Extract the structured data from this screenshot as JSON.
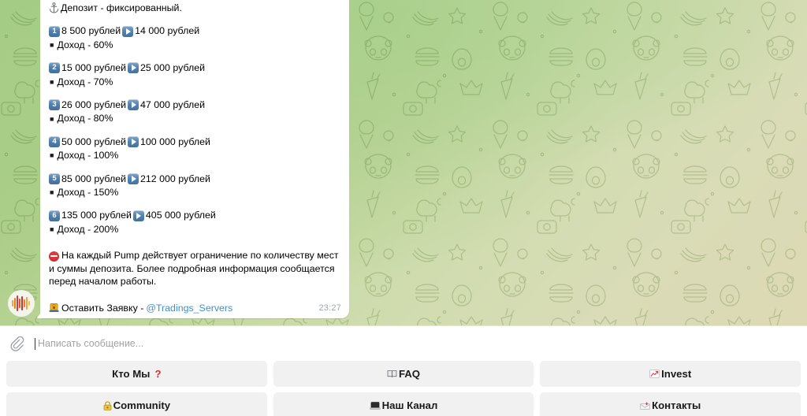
{
  "wallpaper": {
    "colors": {
      "green": "#9ec97f",
      "mid": "#cedcad",
      "khaki": "#d9dcb7"
    }
  },
  "message": {
    "avatar_icon": "audio-waveform-avatar",
    "header": {
      "icon": "anchor-icon",
      "text": "Депозит - фиксированный."
    },
    "tiers": [
      {
        "num": "1",
        "from": "8 500 рублей",
        "to": "14 000 рублей",
        "income": "Доход - 60%"
      },
      {
        "num": "2",
        "from": "15 000 рублей",
        "to": "25 000 рублей",
        "income": "Доход - 70%"
      },
      {
        "num": "3",
        "from": "26 000 рублей",
        "to": "47 000 рублей",
        "income": "Доход - 80%"
      },
      {
        "num": "4",
        "from": "50 000 рублей",
        "to": "100 000 рублей",
        "income": "Доход - 100%"
      },
      {
        "num": "5",
        "from": "85 000 рублей",
        "to": "212 000 рублей",
        "income": "Доход - 150%"
      },
      {
        "num": "6",
        "from": "135 000 рублей",
        "to": "405 000 рублей",
        "income": "Доход - 200%"
      }
    ],
    "warning": {
      "icon": "no-entry-icon",
      "text": "На каждый Pump действует ограничение по количеству мест и суммы депозита. Более подробная информация сообщается перед началом работы."
    },
    "footer": {
      "icon": "locked-laptop-icon",
      "label": "Оставить Заявку -",
      "link": "@Tradings_Servers"
    },
    "time": "23:27"
  },
  "composer": {
    "attach_icon": "paperclip-icon",
    "placeholder": "Написать сообщение...",
    "value": ""
  },
  "keyboard": {
    "rows": [
      [
        {
          "label": "Кто Мы",
          "suffix": "?",
          "icon": null
        },
        {
          "label": "FAQ",
          "suffix": "",
          "icon": "book-icon"
        },
        {
          "label": "Invest",
          "suffix": "",
          "icon": "chart-up-icon"
        }
      ],
      [
        {
          "label": "Community",
          "suffix": "",
          "icon": "lock-icon"
        },
        {
          "label": "Наш Канал",
          "suffix": "",
          "icon": "laptop-icon"
        },
        {
          "label": "Контакты",
          "suffix": "",
          "icon": "mail-icon"
        }
      ]
    ]
  }
}
